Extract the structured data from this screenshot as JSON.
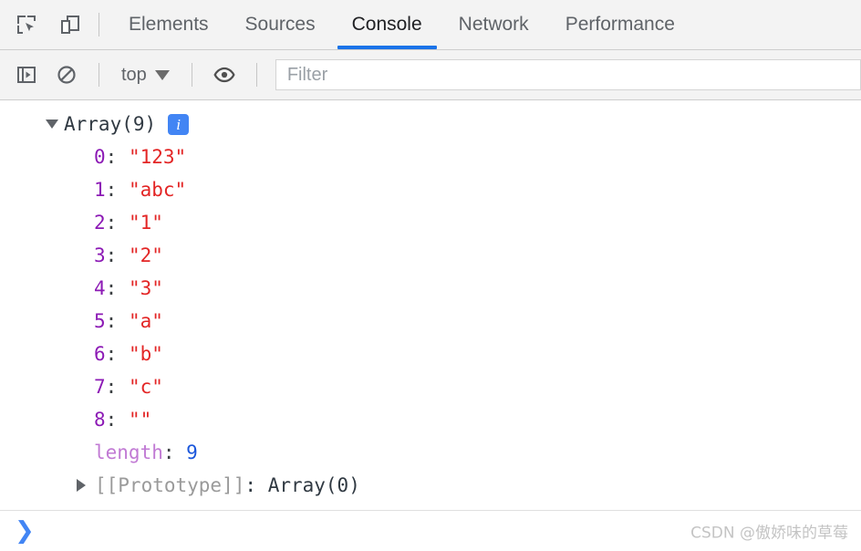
{
  "toolbar_top": {
    "inspect_icon": "inspect-element-icon",
    "device_icon": "device-toolbar-icon",
    "tabs": [
      {
        "label": "Elements",
        "active": false
      },
      {
        "label": "Sources",
        "active": false
      },
      {
        "label": "Console",
        "active": true
      },
      {
        "label": "Network",
        "active": false
      },
      {
        "label": "Performance",
        "active": false
      }
    ],
    "active_underline_color": "#1a73e8"
  },
  "toolbar_console": {
    "sidebar_toggle_icon": "console-sidebar-toggle-icon",
    "clear_icon": "clear-console-icon",
    "context_label": "top",
    "context_caret_icon": "chevron-down-icon",
    "eye_icon": "live-expression-eye-icon",
    "filter_placeholder": "Filter"
  },
  "console_output": {
    "expand_icon": "triangle-down-icon",
    "array_title": "Array(9)",
    "info_badge_label": "i",
    "info_badge_color": "#4285f4",
    "entries": [
      {
        "key": "0",
        "value": "\"123\"",
        "type": "string"
      },
      {
        "key": "1",
        "value": "\"abc\"",
        "type": "string"
      },
      {
        "key": "2",
        "value": "\"1\"",
        "type": "string"
      },
      {
        "key": "3",
        "value": "\"2\"",
        "type": "string"
      },
      {
        "key": "4",
        "value": "\"3\"",
        "type": "string"
      },
      {
        "key": "5",
        "value": "\"a\"",
        "type": "string"
      },
      {
        "key": "6",
        "value": "\"b\"",
        "type": "string"
      },
      {
        "key": "7",
        "value": "\"c\"",
        "type": "string"
      },
      {
        "key": "8",
        "value": "\"\"",
        "type": "string"
      }
    ],
    "length_key": "length",
    "length_value": "9",
    "prototype_arrow_icon": "triangle-right-icon",
    "prototype_key": "[[Prototype]]",
    "prototype_value": "Array(0)",
    "colon": ":",
    "key_color": "#8c1ab5",
    "string_color": "#e32525",
    "number_color": "#1a56db"
  },
  "prompt": {
    "chevron": "❯"
  },
  "watermark": {
    "text": "CSDN @傲娇味的草莓"
  }
}
